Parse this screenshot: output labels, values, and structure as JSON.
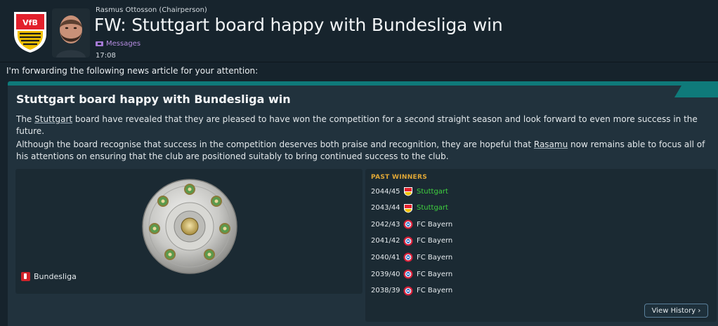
{
  "header": {
    "sender": "Rasmus Ottosson (Chairperson)",
    "subject": "FW: Stuttgart board happy with Bundesliga win",
    "folder": "Messages",
    "time": "17:08"
  },
  "intro": "I'm forwarding the following news article for your attention:",
  "article": {
    "title": "Stuttgart board happy with Bundesliga win",
    "para1_before": "The ",
    "para1_club": "Stuttgart",
    "para1_after": " board have revealed that they are pleased to have won the competition for a second straight season and look forward to even more success in the future.",
    "para2_before": "Although the board recognise that success in the competition deserves both praise and recognition, they are hopeful that ",
    "para2_person": "Rasamu",
    "para2_after": " now remains able to focus all of his attentions on ensuring that the club are positioned suitably to bring continued success to the club.",
    "competition": "Bundesliga"
  },
  "past_winners": {
    "title": "PAST WINNERS",
    "rows": [
      {
        "season": "2044/45",
        "club": "Stuttgart",
        "badge": "stuttgart-badge"
      },
      {
        "season": "2043/44",
        "club": "Stuttgart",
        "badge": "stuttgart-badge"
      },
      {
        "season": "2042/43",
        "club": "FC Bayern",
        "badge": "bayern-badge"
      },
      {
        "season": "2041/42",
        "club": "FC Bayern",
        "badge": "bayern-badge"
      },
      {
        "season": "2040/41",
        "club": "FC Bayern",
        "badge": "bayern-badge"
      },
      {
        "season": "2039/40",
        "club": "FC Bayern",
        "badge": "bayern-badge"
      },
      {
        "season": "2038/39",
        "club": "FC Bayern",
        "badge": "bayern-badge"
      }
    ],
    "button": "View History ›"
  },
  "colors": {
    "accent_teal": "#0f7a7a",
    "winner_green": "#3fd13f",
    "winners_title": "#e0a736",
    "folder_purple": "#b58ce0"
  }
}
